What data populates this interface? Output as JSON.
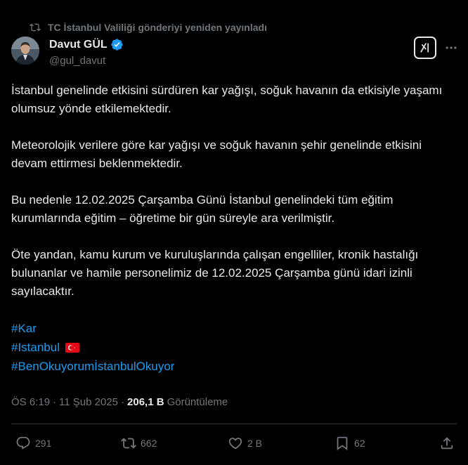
{
  "repost_banner": {
    "text": "TC İstanbul Valiliği gönderiyi yeniden yayınladı"
  },
  "author": {
    "display_name": "Davut GÜL",
    "handle": "@gul_davut",
    "verified": true
  },
  "tweet": {
    "paragraphs": [
      "İstanbul genelinde etkisini sürdüren kar yağışı, soğuk havanın da etkisiyle yaşamı olumsuz yönde etkilemektedir.",
      "Meteorolojik verilere göre kar yağışı ve soğuk havanın şehir genelinde etkisini devam ettirmesi beklenmektedir.",
      "Bu nedenle 12.02.2025 Çarşamba Günü İstanbul genelindeki tüm eğitim kurumlarında eğitim – öğretime bir gün süreyle ara verilmiştir.",
      "Öte yandan, kamu kurum ve kuruluşlarında çalışan engelliler, kronik hastalığı bulunanlar ve hamile personelimiz de 12.02.2025 Çarşamba günü idari izinli sayılacaktır."
    ],
    "hashtags": [
      "#Kar",
      "#Istanbul",
      "#BenOkuyorumİstanbulOkuyor"
    ]
  },
  "meta": {
    "time": "ÖS 6:19",
    "separator": "·",
    "date": "11 Şub 2025",
    "views_count": "206,1 B",
    "views_label": "Görüntüleme"
  },
  "actions": {
    "replies": "291",
    "reposts": "662",
    "likes": "2 B",
    "bookmarks": "62"
  },
  "colors": {
    "background": "#000000",
    "text": "#e7e9ea",
    "muted": "#71767b",
    "link": "#1d9bf0",
    "verified": "#1d9bf0",
    "divider": "#2f3336",
    "flag": "#e30a17"
  },
  "icons": {
    "repost_banner": "repost-icon",
    "verified": "verified-badge-icon",
    "grok": "grok-icon",
    "more": "more-horizontal-icon",
    "flag": "turkey-flag-icon",
    "reply": "reply-icon",
    "repost": "repost-icon",
    "like": "heart-icon",
    "bookmark": "bookmark-icon",
    "share": "share-icon"
  }
}
